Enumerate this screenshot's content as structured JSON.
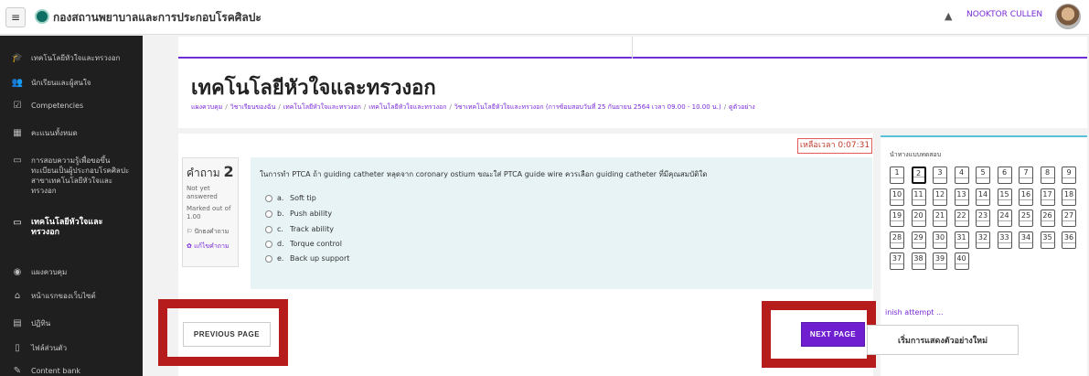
{
  "navbar": {
    "site_name": "กองสถานพยาบาลและการประกอบโรคศิลปะ",
    "username": "NOOKTOR CULLEN",
    "menu_icon": "hamburger-icon",
    "bell_icon": "bell-icon"
  },
  "sidebar": {
    "items": [
      {
        "label": "เทคโนโลยีหัวใจและทรวงอก",
        "icon": "graduation-cap-icon",
        "glyph": "🎓"
      },
      {
        "label": "นักเรียนและผู้สนใจ",
        "icon": "users-icon",
        "glyph": "👥"
      },
      {
        "label": "Competencies",
        "icon": "check-square-icon",
        "glyph": "☑"
      },
      {
        "label": "คะแนนทั้งหมด",
        "icon": "table-icon",
        "glyph": "▦"
      },
      {
        "label": "การสอบความรู้เพื่อขอขึ้นทะเบียนเป็นผู้ประกอบโรคศิลปะ สาขาเทคโนโลยีหัวใจและทรวงอก",
        "icon": "folder-icon",
        "glyph": "▭"
      },
      {
        "label": "เทคโนโลยีหัวใจและทรวงอก",
        "icon": "folder-icon",
        "glyph": "▭",
        "active": true
      },
      {
        "label": "แผงควบคุม",
        "icon": "dashboard-icon",
        "glyph": "◉"
      },
      {
        "label": "หน้าแรกของเว็บไซต์",
        "icon": "home-icon",
        "glyph": "⌂"
      },
      {
        "label": "ปฏิทิน",
        "icon": "calendar-icon",
        "glyph": "▤"
      },
      {
        "label": "ไฟล์ส่วนตัว",
        "icon": "file-icon",
        "glyph": "▯"
      },
      {
        "label": "Content bank",
        "icon": "pencil-icon",
        "glyph": "✎"
      }
    ]
  },
  "header": {
    "title": "เทคโนโลยีหัวใจและทรวงอก",
    "breadcrumb": [
      "แผงควบคุม",
      "วิชาเรียนของฉัน",
      "เทคโนโลยีหัวใจและทรวงอก",
      "เทคโนโลยีหัวใจและทรวงอก",
      "วิชาเทคโนโลยีหัวใจและทรวงอก (การซ้อมสอบวันที่ 25 กันยายน 2564 เวลา 09.00 - 10.00 น.)",
      "ดูตัวอย่าง"
    ]
  },
  "timer": {
    "text": "เหลือเวลา 0:07:31"
  },
  "question": {
    "label": "คำถาม",
    "number": "2",
    "state": "Not yet answered",
    "marks": "Marked out of 1.00",
    "flag": "ปักธงคำถาม",
    "edit": "แก้ไขคำถาม",
    "text": "ในการทำ PTCA ถ้า guiding catheter หลุดจาก coronary ostium ขณะใส่ PTCA guide wire ควรเลือก guiding catheter ที่มีคุณสมบัติใด",
    "options": [
      {
        "letter": "a.",
        "text": "Soft tip"
      },
      {
        "letter": "b.",
        "text": "Push ability"
      },
      {
        "letter": "c.",
        "text": "Track ability"
      },
      {
        "letter": "d.",
        "text": "Torque control"
      },
      {
        "letter": "e.",
        "text": "Back up support"
      }
    ]
  },
  "buttons": {
    "previous": "PREVIOUS PAGE",
    "next": "NEXT PAGE"
  },
  "quiz_nav": {
    "title": "นำทางแบบทดสอบ",
    "current": 2,
    "numbers": [
      "1",
      "2",
      "3",
      "4",
      "5",
      "6",
      "7",
      "8",
      "9",
      "10",
      "11",
      "12",
      "13",
      "14",
      "15",
      "16",
      "17",
      "18",
      "19",
      "20",
      "21",
      "22",
      "23",
      "24",
      "25",
      "26",
      "27",
      "28",
      "29",
      "30",
      "31",
      "32",
      "33",
      "34",
      "35",
      "36",
      "37",
      "38",
      "39",
      "40"
    ],
    "finish": "inish attempt ...",
    "restart": "เริ่มการแสดงตัวอย่างใหม่"
  },
  "colors": {
    "accent": "#6f1fd0",
    "highlight": "#b71c1c",
    "sidebar": "#1f1f1f",
    "info_box": "#e7f3f5"
  }
}
